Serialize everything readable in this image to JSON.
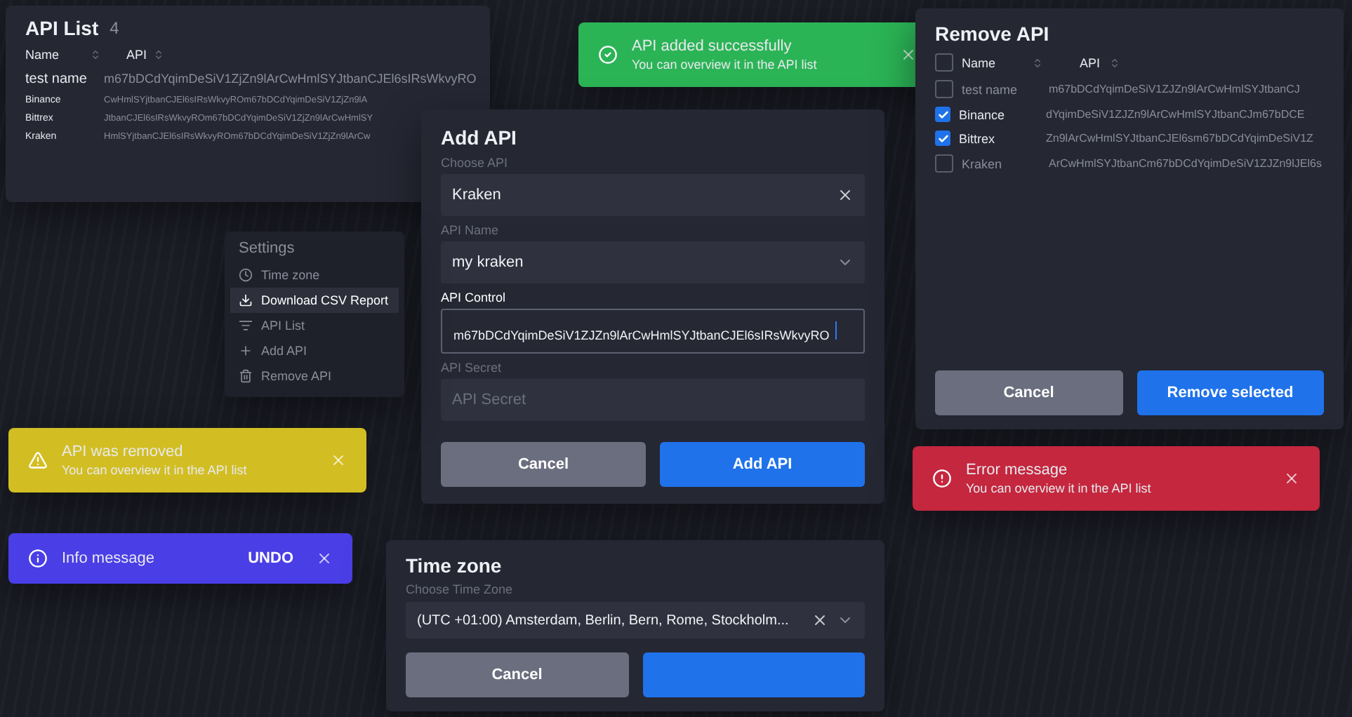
{
  "api_list": {
    "title": "API List",
    "count": "4",
    "columns": [
      "Name",
      "API"
    ],
    "rows": [
      {
        "name": "test name",
        "api": "m67bDCdYqimDeSiV1ZjZn9lArCwHmlSYJtbanCJEl6sIRsWkvyRO",
        "emphasis": true
      },
      {
        "name": "Binance",
        "api": "CwHmlSYjtbanCJEl6sIRsWkvyROm67bDCdYqimDeSiV1ZjZn9lA",
        "emphasis": false
      },
      {
        "name": "Bittrex",
        "api": "JtbanCJEl6sIRsWkvyROm67bDCdYqimDeSiV1ZjZn9lArCwHmlSY",
        "emphasis": false
      },
      {
        "name": "Kraken",
        "api": "HmlSYjtbanCJEl6sIRsWkvyROm67bDCdYqimDeSiV1ZjZn9lArCw",
        "emphasis": false
      }
    ]
  },
  "success_toast": {
    "kind": "success",
    "title": "API added successfully",
    "message": "You can overview it in the API list"
  },
  "add_api": {
    "title": "Add API",
    "fields": [
      {
        "kind": "clearable",
        "label": "Choose API",
        "value": "Kraken"
      },
      {
        "kind": "select",
        "label": "API Name",
        "value": "my kraken"
      },
      {
        "kind": "focused",
        "label": "API Control",
        "value": "m67bDCdYqimDeSiV1ZJZn9lArCwHmlSYJtbanCJEl6sIRsWkvyRO"
      },
      {
        "kind": "empty",
        "label": "API Secret",
        "placeholder": "API Secret"
      }
    ],
    "buttons": [
      "Cancel",
      "Add API"
    ]
  },
  "settings_menu": {
    "title": "Settings",
    "items": [
      {
        "label": "Time zone",
        "selected": false
      },
      {
        "label": "Download CSV Report",
        "selected": true
      },
      {
        "label": "API List",
        "selected": false
      },
      {
        "label": "Add API",
        "selected": false
      },
      {
        "label": "Remove API",
        "selected": false
      }
    ]
  },
  "remove_api": {
    "title": "Remove API",
    "all_checked": false,
    "columns": [
      "Name",
      "API"
    ],
    "rows": [
      {
        "name": "test name",
        "api": "m67bDCdYqimDeSiV1ZJZn9lArCwHmlSYJtbanCJ",
        "checked": false
      },
      {
        "name": "Binance",
        "api": "dYqimDeSiV1ZJZn9lArCwHmlSYJtbanCJm67bDCE",
        "checked": true
      },
      {
        "name": "Bittrex",
        "api": "Zn9lArCwHmlSYJtbanCJEl6sm67bDCdYqimDeSiV1Z",
        "checked": true
      },
      {
        "name": "Kraken",
        "api": "ArCwHmlSYJtbanCm67bDCdYqimDeSiV1ZJZn9lJEl6s",
        "checked": false
      }
    ],
    "buttons": [
      "Cancel",
      "Remove selected"
    ]
  },
  "warning_toast": {
    "kind": "warning",
    "title": "API was removed",
    "message": "You can overview it in the API list"
  },
  "error_toast": {
    "kind": "error",
    "title": "Error message",
    "message": "You can overview it in the API list"
  },
  "info_toast": {
    "kind": "info",
    "title": "Info message",
    "action": "UNDO"
  },
  "time_zone": {
    "title": "Time zone",
    "label": "Choose Time Zone",
    "value": "(UTC +01:00) Amsterdam, Berlin, Bern, Rome, Stockholm...",
    "buttons": [
      "Cancel"
    ]
  }
}
